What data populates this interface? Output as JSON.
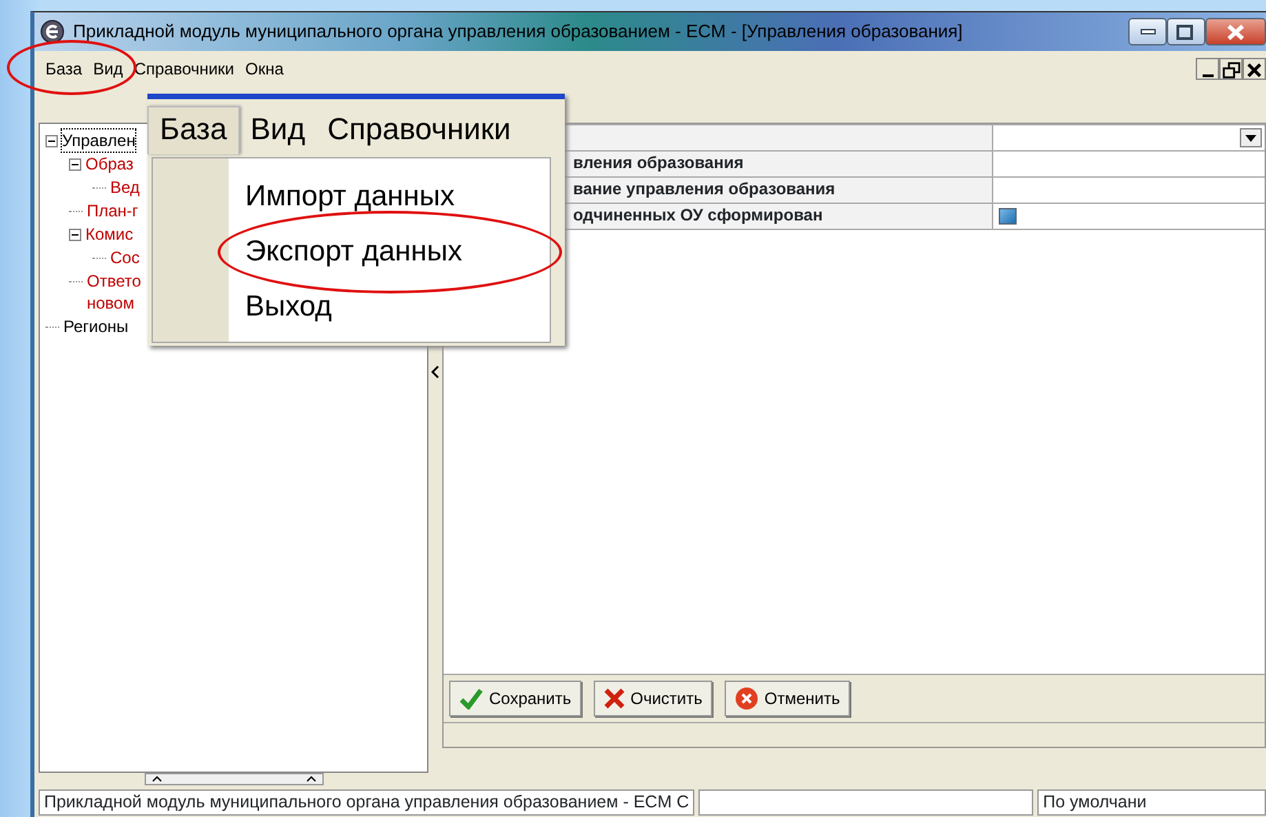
{
  "window": {
    "title": "Прикладной модуль муниципального органа управления образованием - ECM - [Управления образования]"
  },
  "menu": [
    {
      "label": "База",
      "circled": true
    },
    {
      "label": "Вид",
      "circled": true
    },
    {
      "label": "Справочники",
      "circled": false
    },
    {
      "label": "Окна",
      "circled": false
    }
  ],
  "tree": [
    {
      "label": "Управлен",
      "color": "#000000",
      "expanded": true,
      "children": [
        {
          "label": "Образ",
          "color": "#c00000",
          "expanded": true,
          "children": [
            {
              "label": "Вед",
              "color": "#c00000"
            }
          ]
        },
        {
          "label": "План-г",
          "color": "#c00000"
        },
        {
          "label": "Комис",
          "color": "#c00000",
          "expanded": true,
          "children": [
            {
              "label": "Сос",
              "color": "#c00000"
            }
          ]
        },
        {
          "label": "Ответо новом",
          "color": "#c00000"
        }
      ]
    },
    {
      "label": "Регионы",
      "color": "#000000"
    }
  ],
  "properties": [
    {
      "kind": "dropdown"
    },
    {
      "kind": "text",
      "label": "вления образования"
    },
    {
      "kind": "text",
      "label": "вание управления образования"
    },
    {
      "kind": "checkbox",
      "label": "одчиненных ОУ сформирован",
      "checked": true
    }
  ],
  "buttons": [
    {
      "label": "Сохранить",
      "kind": "save"
    },
    {
      "label": "Очистить",
      "kind": "clear"
    },
    {
      "label": "Отменить",
      "kind": "cancel"
    }
  ],
  "status_bar": [
    {
      "text": "Прикладной модуль муниципального органа управления образованием - ECM C"
    },
    {
      "text": "По умолчани"
    }
  ],
  "zoom_inset": {
    "menu": [
      {
        "label": "База",
        "selected": true
      },
      {
        "label": "Вид",
        "selected": false
      },
      {
        "label": "Справочники",
        "selected": false
      }
    ],
    "items": [
      {
        "label": "Импорт данных",
        "circled": false
      },
      {
        "label": "Экспорт данных",
        "circled": true
      },
      {
        "label": "Выход",
        "circled": false
      }
    ]
  }
}
